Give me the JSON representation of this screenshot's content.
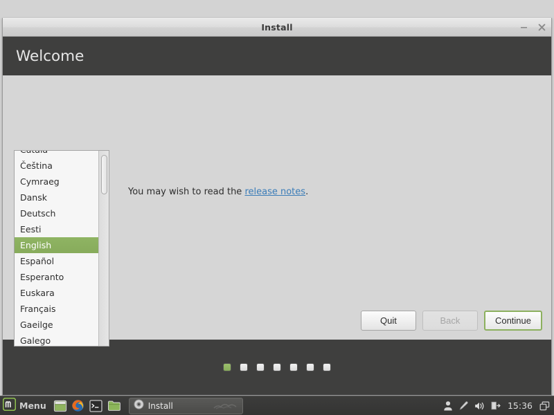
{
  "window": {
    "title": "Install",
    "header_title": "Welcome",
    "minimize_label": "minimize-icon",
    "close_label": "close-icon"
  },
  "language_list": {
    "items": [
      {
        "label": "Català",
        "selected": false,
        "clipped": "top"
      },
      {
        "label": "Čeština",
        "selected": false
      },
      {
        "label": "Cymraeg",
        "selected": false
      },
      {
        "label": "Dansk",
        "selected": false
      },
      {
        "label": "Deutsch",
        "selected": false
      },
      {
        "label": "Eesti",
        "selected": false
      },
      {
        "label": "English",
        "selected": true
      },
      {
        "label": "Español",
        "selected": false
      },
      {
        "label": "Esperanto",
        "selected": false
      },
      {
        "label": "Euskara",
        "selected": false
      },
      {
        "label": "Français",
        "selected": false
      },
      {
        "label": "Gaeilge",
        "selected": false
      },
      {
        "label": "Galego",
        "selected": false,
        "clipped": "bottom"
      }
    ],
    "selected_value": "English"
  },
  "content": {
    "notes_prefix": "You may wish to read the ",
    "notes_link": "release notes",
    "notes_suffix": "."
  },
  "buttons": {
    "quit": "Quit",
    "back": "Back",
    "continue": "Continue"
  },
  "progress": {
    "total_steps": 7,
    "current_step": 1
  },
  "taskbar": {
    "menu_label": "Menu",
    "launchers": [
      "show-desktop-icon",
      "firefox-icon",
      "terminal-icon",
      "files-icon"
    ],
    "task_label": "Install",
    "task_icon": "disc-icon",
    "tray": [
      "user-icon",
      "update-manager-icon",
      "volume-icon",
      "removable-media-icon",
      "window-list-icon"
    ],
    "clock": "15:36"
  },
  "colors": {
    "accent_green": "#8cb05e",
    "header_dark": "#3f3f3e",
    "link_blue": "#3a7cb8",
    "body_gray": "#d6d6d6",
    "taskbar_dark": "#3a3a39"
  }
}
